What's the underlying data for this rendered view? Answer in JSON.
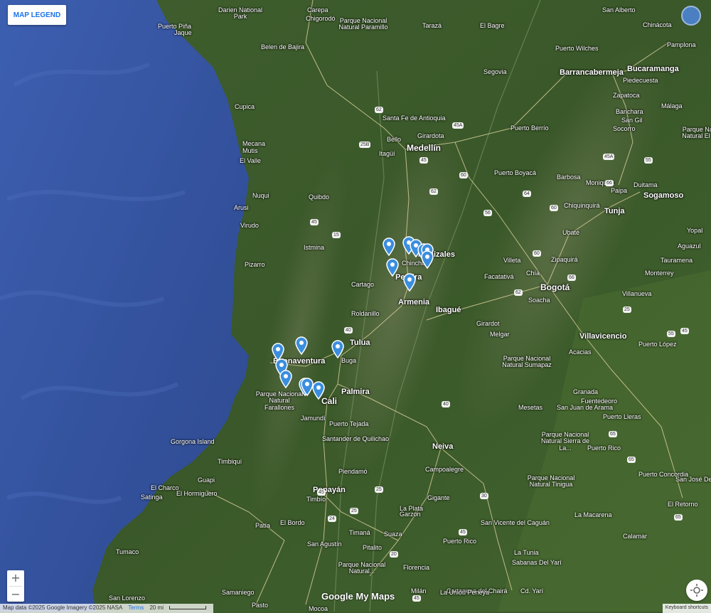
{
  "legend_button": "MAP LEGEND",
  "zoom": {
    "in": "+",
    "out": "−"
  },
  "footer": {
    "attribution": "Map data ©2025 Google Imagery ©2025 NASA",
    "terms": "Terms",
    "scale": "20 mi",
    "keyboard": "Keyboard shortcuts",
    "logo": "Google My Maps"
  },
  "colors": {
    "ocean": "#3b5aa6",
    "land": "#3d5c2d",
    "pin": "#3b8ede",
    "button_text": "#1a73e8"
  },
  "map": {
    "pin_count": 16,
    "major_cities": [
      "Medellín",
      "Bogotá",
      "Cali",
      "Pereira",
      "Armenia",
      "Ibagué",
      "Barrancabermeja",
      "Bucaramanga",
      "Tunja",
      "Sogamoso",
      "Villavicencio",
      "Neiva",
      "Popayán",
      "Palmira",
      "Tulua",
      "Buenaventura",
      "Manizales"
    ],
    "places": [
      "Darien National Park",
      "Puerto Piña",
      "Jaque",
      "Carepa",
      "Chigorodó",
      "Parque Nacional Natural Paramillo",
      "Tarazá",
      "El Bagre",
      "San Alberto",
      "Chinácota",
      "Pamplona",
      "Belen de Bajira",
      "Puerto Wilches",
      "Segovia",
      "Piedecuesta",
      "Zapatoca",
      "Barichara",
      "San Gil",
      "Socorro",
      "Málaga",
      "Parque Nacional Natural El Cocuy",
      "Cupica",
      "Santa Fe de Antioquia",
      "Girardota",
      "Bello",
      "Itagüí",
      "Puerto Berrío",
      "Mecana",
      "Mutis",
      "El Valle",
      "Puerto Boyacá",
      "Barbosa",
      "Moniquirá",
      "Paipa",
      "Duitama",
      "Nuqui",
      "Quibdo",
      "Chiquinquirá",
      "Arusi",
      "Virudo",
      "Ubaté",
      "Istmina",
      "Chinchiná",
      "Villeta",
      "Zipaquirá",
      "Chía",
      "Yopal",
      "Aguazul",
      "Tauramena",
      "Pizarro",
      "Facatativá",
      "Monterrey",
      "Cartago",
      "Soacha",
      "Villanueva",
      "Roldanillo",
      "Girardot",
      "Melgar",
      "Acacias",
      "Puerto López",
      "Buga",
      "Parque Nacional Natural Sumapaz",
      "Parque Nacional Natural Farallones",
      "Jamundí",
      "Granada",
      "Fuentedeoro",
      "Mesetas",
      "San Juan de Arama",
      "Puerto Lleras",
      "Gorgona Island",
      "Puerto Tejada",
      "Santander de Quilichao",
      "Parque Nacional Natural Sierra de La...",
      "Puerto Rico",
      "Timbiquí",
      "Piendamó",
      "Campoalegre",
      "Puerto Concordia",
      "San José Del Guaviare",
      "Guapi",
      "El Charco",
      "Satinga",
      "El Hormiguero",
      "Timbío",
      "La Plata",
      "Gigante",
      "Parque Nacional Natural Tinigua",
      "El Retorno",
      "Patía",
      "El Bordo",
      "Garzón",
      "La Macarena",
      "Timaná",
      "Suaza",
      "San Vicente del Caguán",
      "Calamar",
      "San Agustín",
      "Pitalito",
      "Puerto Rico",
      "Tumaco",
      "La Tunia",
      "Sabanas Del Yarí",
      "Florencia",
      "Samaniego",
      "San Lorenzo",
      "Milán",
      "Cartagena del Chairá",
      "La Unión Peneya",
      "Cd. Yarí",
      "Pasto",
      "Mocoa",
      "Parque Nacional Natural..."
    ],
    "road_shields": [
      "62",
      "45A",
      "45",
      "25B",
      "60",
      "62",
      "56",
      "60",
      "64",
      "45A",
      "66",
      "55",
      "60",
      "66",
      "15",
      "45",
      "62",
      "25",
      "40",
      "45",
      "40",
      "65",
      "25",
      "45",
      "25",
      "65",
      "24",
      "45",
      "20",
      "30",
      "45",
      "65",
      "55"
    ]
  }
}
